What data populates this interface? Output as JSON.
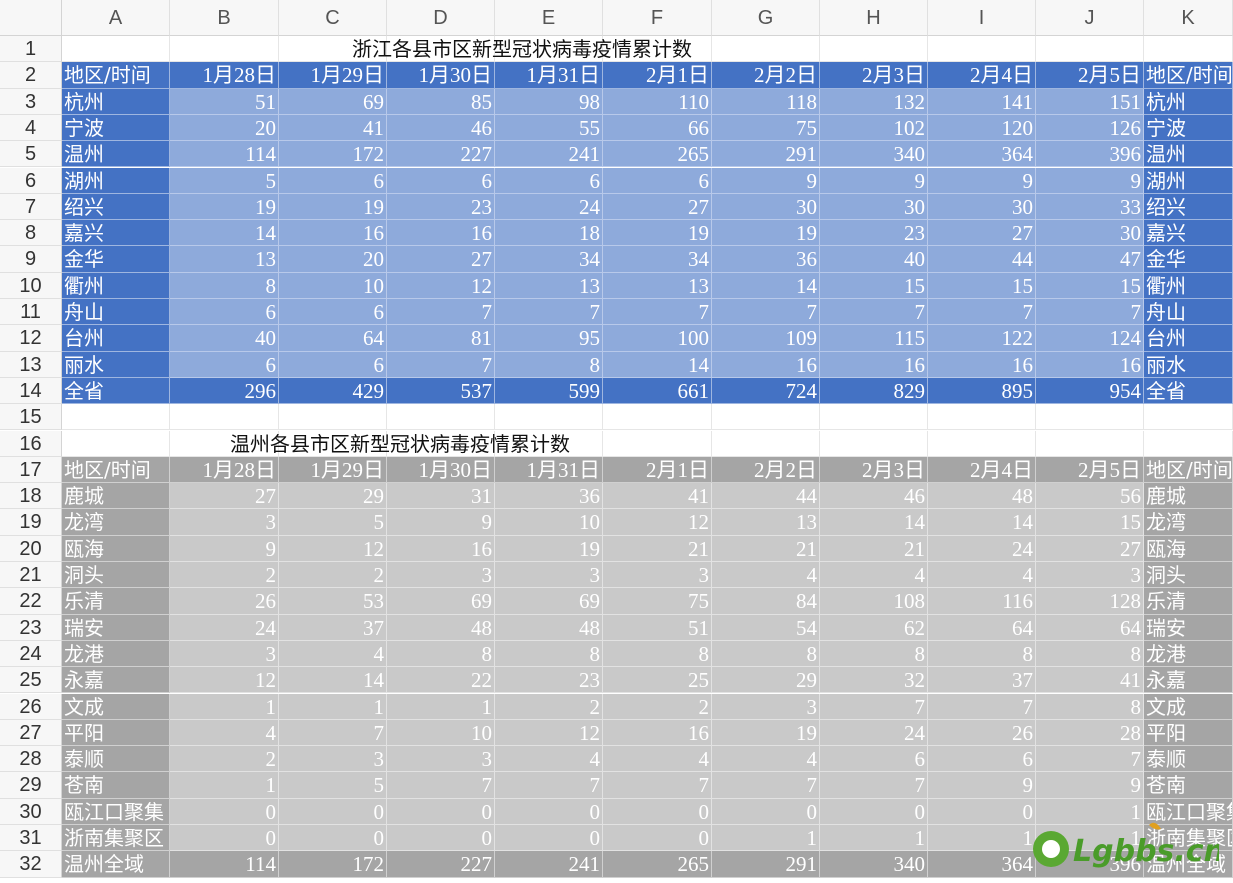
{
  "columns": [
    "A",
    "B",
    "C",
    "D",
    "E",
    "F",
    "G",
    "H",
    "I",
    "J",
    "K"
  ],
  "rows": [
    "1",
    "2",
    "3",
    "4",
    "5",
    "6",
    "7",
    "8",
    "9",
    "10",
    "11",
    "12",
    "13",
    "14",
    "15",
    "16",
    "17",
    "18",
    "19",
    "20",
    "21",
    "22",
    "23",
    "24",
    "25",
    "26",
    "27",
    "28",
    "29",
    "30",
    "31",
    "32"
  ],
  "table1": {
    "title": "浙江各县市区新型冠状病毒疫情累计数",
    "header_label": "地区/时间",
    "dates": [
      "1月28日",
      "1月29日",
      "1月30日",
      "1月31日",
      "2月1日",
      "2月2日",
      "2月3日",
      "2月4日",
      "2月5日"
    ],
    "rows": [
      {
        "name": "杭州",
        "values": [
          51,
          69,
          85,
          98,
          110,
          118,
          132,
          141,
          151
        ]
      },
      {
        "name": "宁波",
        "values": [
          20,
          41,
          46,
          55,
          66,
          75,
          102,
          120,
          126
        ]
      },
      {
        "name": "温州",
        "values": [
          114,
          172,
          227,
          241,
          265,
          291,
          340,
          364,
          396
        ]
      },
      {
        "name": "湖州",
        "values": [
          5,
          6,
          6,
          6,
          6,
          9,
          9,
          9,
          9
        ]
      },
      {
        "name": "绍兴",
        "values": [
          19,
          19,
          23,
          24,
          27,
          30,
          30,
          30,
          33
        ]
      },
      {
        "name": "嘉兴",
        "values": [
          14,
          16,
          16,
          18,
          19,
          19,
          23,
          27,
          30
        ]
      },
      {
        "name": "金华",
        "values": [
          13,
          20,
          27,
          34,
          34,
          36,
          40,
          44,
          47
        ]
      },
      {
        "name": "衢州",
        "values": [
          8,
          10,
          12,
          13,
          13,
          14,
          15,
          15,
          15
        ]
      },
      {
        "name": "舟山",
        "values": [
          6,
          6,
          7,
          7,
          7,
          7,
          7,
          7,
          7
        ]
      },
      {
        "name": "台州",
        "values": [
          40,
          64,
          81,
          95,
          100,
          109,
          115,
          122,
          124
        ]
      },
      {
        "name": "丽水",
        "values": [
          6,
          6,
          7,
          8,
          14,
          16,
          16,
          16,
          16
        ]
      },
      {
        "name": "全省",
        "values": [
          296,
          429,
          537,
          599,
          661,
          724,
          829,
          895,
          954
        ]
      }
    ]
  },
  "table2": {
    "title": "温州各县市区新型冠状病毒疫情累计数",
    "header_label": "地区/时间",
    "dates": [
      "1月28日",
      "1月29日",
      "1月30日",
      "1月31日",
      "2月1日",
      "2月2日",
      "2月3日",
      "2月4日",
      "2月5日"
    ],
    "rows": [
      {
        "name": "鹿城",
        "values": [
          27,
          29,
          31,
          36,
          41,
          44,
          46,
          48,
          56
        ]
      },
      {
        "name": "龙湾",
        "values": [
          3,
          5,
          9,
          10,
          12,
          13,
          14,
          14,
          15
        ]
      },
      {
        "name": "瓯海",
        "values": [
          9,
          12,
          16,
          19,
          21,
          21,
          21,
          24,
          27
        ]
      },
      {
        "name": "洞头",
        "values": [
          2,
          2,
          3,
          3,
          3,
          4,
          4,
          4,
          3
        ]
      },
      {
        "name": "乐清",
        "values": [
          26,
          53,
          69,
          69,
          75,
          84,
          108,
          116,
          128
        ]
      },
      {
        "name": "瑞安",
        "values": [
          24,
          37,
          48,
          48,
          51,
          54,
          62,
          64,
          64
        ]
      },
      {
        "name": "龙港",
        "values": [
          3,
          4,
          8,
          8,
          8,
          8,
          8,
          8,
          8
        ]
      },
      {
        "name": "永嘉",
        "values": [
          12,
          14,
          22,
          23,
          25,
          29,
          32,
          37,
          41
        ]
      },
      {
        "name": "文成",
        "values": [
          1,
          1,
          1,
          2,
          2,
          3,
          7,
          7,
          8
        ]
      },
      {
        "name": "平阳",
        "values": [
          4,
          7,
          10,
          12,
          16,
          19,
          24,
          26,
          28
        ]
      },
      {
        "name": "泰顺",
        "values": [
          2,
          3,
          3,
          4,
          4,
          4,
          6,
          6,
          7
        ]
      },
      {
        "name": "苍南",
        "values": [
          1,
          5,
          7,
          7,
          7,
          7,
          7,
          9,
          9
        ]
      },
      {
        "name": "瓯江口聚集",
        "values": [
          0,
          0,
          0,
          0,
          0,
          0,
          0,
          0,
          1
        ]
      },
      {
        "name": "浙南集聚区",
        "values": [
          0,
          0,
          0,
          0,
          0,
          1,
          1,
          1,
          1
        ]
      },
      {
        "name": "温州全域",
        "values": [
          114,
          172,
          227,
          241,
          265,
          291,
          340,
          364,
          396
        ]
      }
    ]
  },
  "watermark": {
    "text": "Lgbbs.cn"
  }
}
